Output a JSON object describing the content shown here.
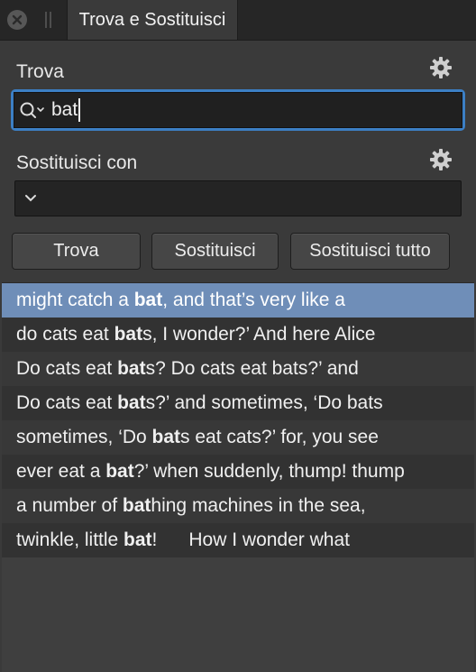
{
  "window": {
    "tab_title": "Trova e Sostituisci",
    "close_icon": "close-icon",
    "grip_icon": "panel-grip-icon"
  },
  "find": {
    "label": "Trova",
    "value": "bat",
    "options_icon": "gear-icon",
    "search_icon": "search-icon"
  },
  "replace": {
    "label": "Sostituisci con",
    "value": "",
    "options_icon": "gear-icon",
    "dropdown_icon": "chevron-down-icon"
  },
  "buttons": {
    "find": "Trova",
    "replace": "Sostituisci",
    "replace_all": "Sostituisci tutto"
  },
  "results": [
    {
      "before": "might catch a ",
      "match": "bat",
      "after": ", and that’s very like a",
      "selected": true
    },
    {
      "before": "do cats eat ",
      "match": "bat",
      "after": "s, I wonder?’ And here Alice",
      "selected": false
    },
    {
      "before": "Do cats eat ",
      "match": "bat",
      "after": "s? Do cats eat bats?’ and",
      "selected": false
    },
    {
      "before": "Do cats eat ",
      "match": "bat",
      "after": "s?’ and sometimes, ‘Do bats",
      "selected": false
    },
    {
      "before": "sometimes, ‘Do ",
      "match": "bat",
      "after": "s eat cats?’ for, you see",
      "selected": false
    },
    {
      "before": "ever eat a ",
      "match": "bat",
      "after": "?’ when suddenly, thump! thump",
      "selected": false
    },
    {
      "before": "a number of ",
      "match": "bat",
      "after": "hing machines in the sea,",
      "selected": false
    },
    {
      "before": "twinkle, little ",
      "match": "bat",
      "after": "!      How I wonder what",
      "selected": false
    }
  ],
  "colors": {
    "accent": "#3c7fc4",
    "selected_row": "#6f8eb8"
  }
}
